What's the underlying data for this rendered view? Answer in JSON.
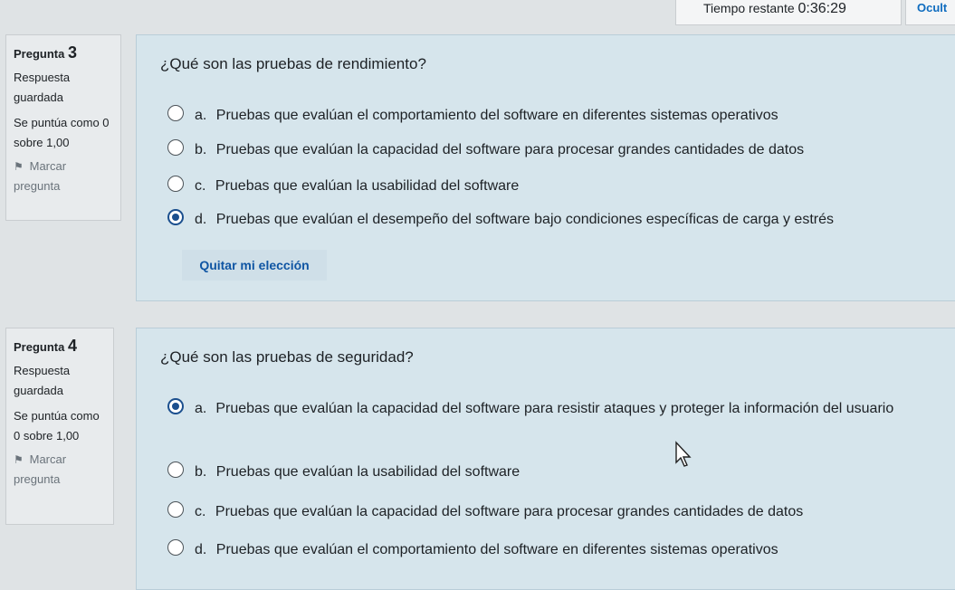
{
  "timer": {
    "label": "Tiempo restante",
    "value": "0:36:29"
  },
  "hide_button": "Ocult",
  "questions": [
    {
      "title": "Pregunta",
      "number": "3",
      "status": "Respuesta guardada",
      "score": "Se puntúa como 0 sobre 1,00",
      "flag": "Marcar pregunta",
      "text": "¿Qué son las pruebas de rendimiento?",
      "answers": [
        {
          "letter": "a.",
          "text": "Pruebas que evalúan el comportamiento del software en diferentes sistemas operativos",
          "selected": false
        },
        {
          "letter": "b.",
          "text": "Pruebas que evalúan la capacidad del software para procesar grandes cantidades de datos",
          "selected": false
        },
        {
          "letter": "c.",
          "text": "Pruebas que evalúan la usabilidad del software",
          "selected": false
        },
        {
          "letter": "d.",
          "text": "Pruebas que evalúan el desempeño del software bajo condiciones específicas de carga y estrés",
          "selected": true
        }
      ],
      "clear_choice": "Quitar mi elección"
    },
    {
      "title": "Pregunta",
      "number": "4",
      "status": "Respuesta guardada",
      "score": "Se puntúa como 0 sobre 1,00",
      "flag": "Marcar pregunta",
      "text": "¿Qué son las pruebas de seguridad?",
      "answers": [
        {
          "letter": "a.",
          "text": "Pruebas que evalúan la capacidad del software para resistir ataques y proteger la información del usuario",
          "selected": true
        },
        {
          "letter": "b.",
          "text": "Pruebas que evalúan la usabilidad del software",
          "selected": false
        },
        {
          "letter": "c.",
          "text": "Pruebas que evalúan la capacidad del software para procesar grandes cantidades de datos",
          "selected": false
        },
        {
          "letter": "d.",
          "text": "Pruebas que evalúan el comportamiento del software en diferentes sistemas operativos",
          "selected": false
        }
      ]
    }
  ],
  "colors": {
    "accent": "#0f6cbf",
    "selected_radio": "#1b4f8e",
    "content_bg": "#d6e5ec"
  }
}
